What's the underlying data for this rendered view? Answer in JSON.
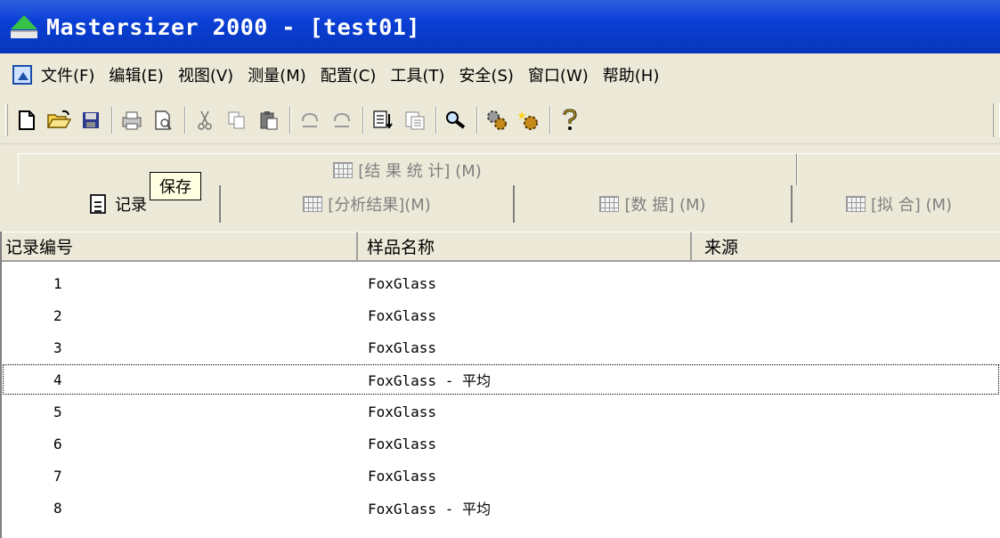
{
  "window": {
    "title": "Mastersizer 2000 - [test01]"
  },
  "menu": {
    "items": [
      {
        "label": "文件(F)"
      },
      {
        "label": "编辑(E)"
      },
      {
        "label": "视图(V)"
      },
      {
        "label": "测量(M)"
      },
      {
        "label": "配置(C)"
      },
      {
        "label": "工具(T)"
      },
      {
        "label": "安全(S)"
      },
      {
        "label": "窗口(W)"
      },
      {
        "label": "帮助(H)"
      }
    ]
  },
  "toolbar": {
    "icons": [
      "new-icon",
      "open-icon",
      "save-icon",
      "print-icon",
      "print-preview-icon",
      "cut-icon",
      "copy-icon",
      "paste-icon",
      "undo-icon",
      "redo-icon",
      "sort-icon",
      "report-icon",
      "search-icon",
      "settings-icon",
      "settings-wizard-icon",
      "help-icon"
    ]
  },
  "tabs": {
    "top": [
      {
        "label": "[结 果 统 计] (M)"
      }
    ],
    "bottom": [
      {
        "label": "记录",
        "active": true
      },
      {
        "label": "[分析结果](M)"
      },
      {
        "label": "[数 据] (M)"
      },
      {
        "label": "[拟 合] (M)"
      }
    ]
  },
  "tooltip": {
    "text": "保存"
  },
  "table": {
    "columns": [
      "记录编号",
      "样品名称",
      "来源"
    ],
    "rows": [
      {
        "num": "1",
        "name": "FoxGlass"
      },
      {
        "num": "2",
        "name": "FoxGlass"
      },
      {
        "num": "3",
        "name": "FoxGlass"
      },
      {
        "num": "4",
        "name": "FoxGlass - 平均",
        "selected": true
      },
      {
        "num": "5",
        "name": "FoxGlass"
      },
      {
        "num": "6",
        "name": "FoxGlass"
      },
      {
        "num": "7",
        "name": "FoxGlass"
      },
      {
        "num": "8",
        "name": "FoxGlass - 平均"
      }
    ]
  },
  "colors": {
    "titlebar": "#0a3fd6",
    "chrome": "#ece9d8"
  }
}
